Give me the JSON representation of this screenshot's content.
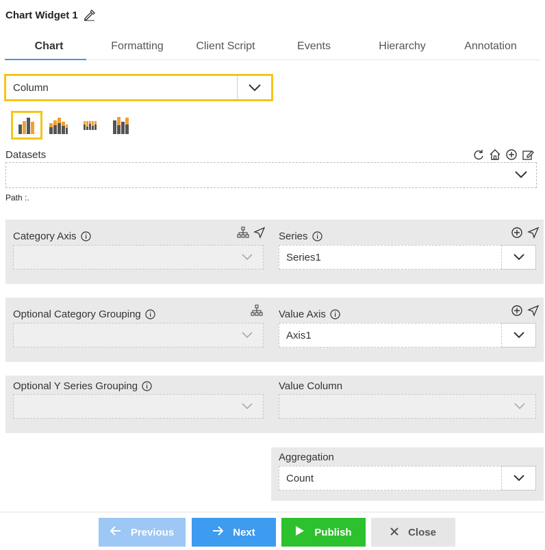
{
  "header": {
    "title": "Chart Widget 1",
    "edit_icon": "edit-icon"
  },
  "tabs": [
    {
      "label": "Chart",
      "active": true
    },
    {
      "label": "Formatting",
      "active": false
    },
    {
      "label": "Client Script",
      "active": false
    },
    {
      "label": "Events",
      "active": false
    },
    {
      "label": "Hierarchy",
      "active": false
    },
    {
      "label": "Annotation",
      "active": false
    }
  ],
  "chart_type": {
    "value": "Column"
  },
  "chart_variants": [
    "clustered-column",
    "stacked-column",
    "stacked-column-100",
    "column-3d"
  ],
  "datasets": {
    "label": "Datasets",
    "value": "",
    "path_label": "Path :."
  },
  "category_axis": {
    "label": "Category Axis",
    "value": ""
  },
  "series": {
    "label": "Series",
    "value": "Series1"
  },
  "optional_category_grouping": {
    "label": "Optional Category Grouping",
    "value": ""
  },
  "value_axis": {
    "label": "Value Axis",
    "value": "Axis1"
  },
  "optional_y_series_grouping": {
    "label": "Optional Y Series Grouping",
    "value": ""
  },
  "value_column": {
    "label": "Value Column",
    "value": ""
  },
  "aggregation": {
    "label": "Aggregation",
    "value": "Count"
  },
  "footer": {
    "previous_label": "Previous",
    "next_label": "Next",
    "publish_label": "Publish",
    "close_label": "Close"
  },
  "colors": {
    "accent_yellow": "#f5c518",
    "tab_underline": "#4a90e2",
    "prev_button": "#9dc7f5",
    "next_button": "#3d9bf0",
    "publish_button": "#2dc12d",
    "close_button": "#e6e6e6",
    "bar_orange": "#f0a030",
    "bar_dark": "#555555"
  }
}
